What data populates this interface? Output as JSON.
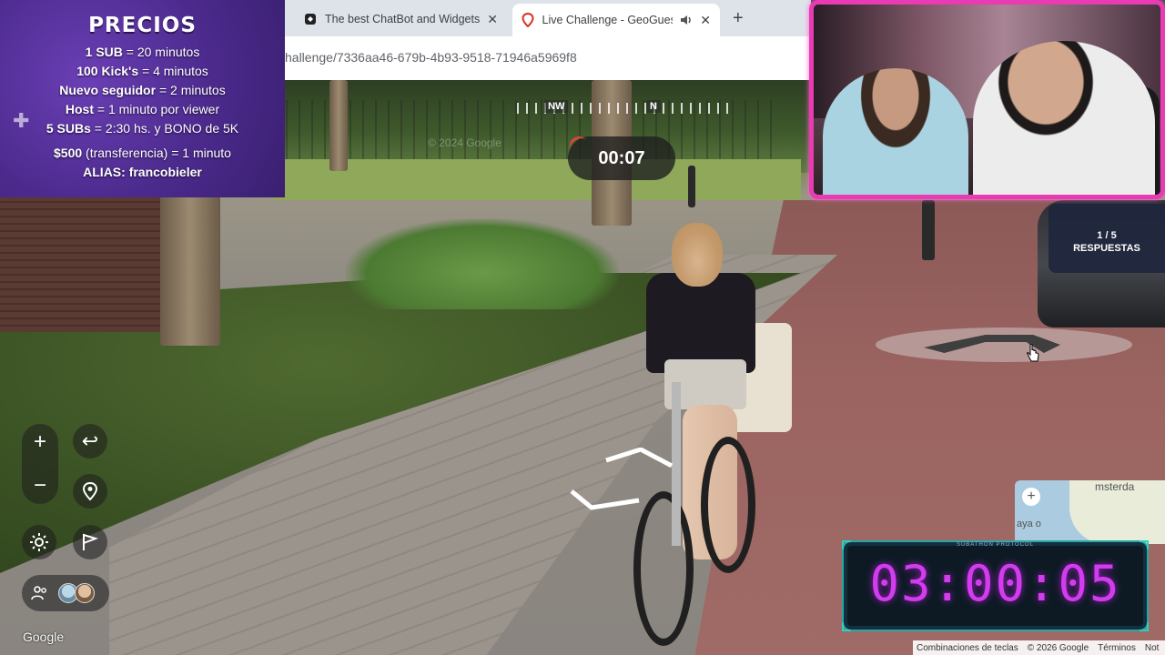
{
  "browser": {
    "tabs": [
      {
        "title": "The best ChatBot and Widgets",
        "icon": "chatbot-icon"
      },
      {
        "title": "Live Challenge - GeoGuessr",
        "icon": "location-pin-icon",
        "audio": "speaker-icon"
      }
    ],
    "url": "hallenge/7336aa46-679b-4b93-9518-71946a5969f8",
    "new_tab": "+",
    "close": "✕"
  },
  "compass": {
    "nw": "NW",
    "n": "N"
  },
  "round_timer": "00:07",
  "prices": {
    "title": "PRECIOS",
    "lines": [
      {
        "bold": "1 SUB",
        "rest": " = 20 minutos"
      },
      {
        "bold": "100 Kick's",
        "rest": " = 4 minutos"
      },
      {
        "bold": "Nuevo seguidor",
        "rest": " = 2 minutos"
      },
      {
        "bold": "Host",
        "rest": " = 1 minuto por viewer"
      },
      {
        "bold": "5 SUBs",
        "rest": " = 2:30 hs. y BONO de 5K"
      },
      {
        "bold": "$500",
        "rest": " (transferencia) = 1 minuto"
      },
      {
        "bold": "ALIAS: francobieler",
        "rest": ""
      }
    ]
  },
  "answers": {
    "count": "1 / 5",
    "label": "RESPUESTAS"
  },
  "controls": {
    "zoom_in": "+",
    "zoom_out": "−",
    "undo": "↩"
  },
  "minimap": {
    "label": "msterda",
    "label2": "aya o"
  },
  "subathon": {
    "tag": "SUBATHON PROTOCOL",
    "clock": "03:00:05",
    "accent": "#d43bf0"
  },
  "attribution": {
    "logo": "Google",
    "shortcuts": "Combinaciones de teclas",
    "copyright": "© 2026 Google",
    "terms": "Términos",
    "more": "Not"
  },
  "scene_watermark": "© 2024 Google",
  "webcam": {
    "border_color": "#e83bb4"
  }
}
